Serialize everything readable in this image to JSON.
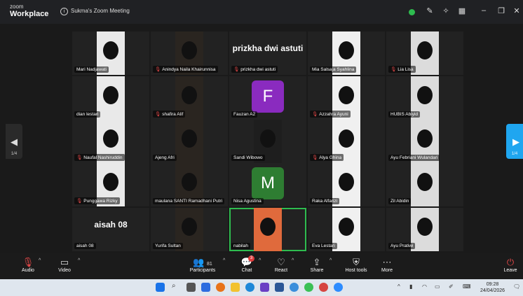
{
  "app": {
    "brand_top": "zoom",
    "brand_bottom": "Workplace",
    "meeting_title": "Sukma's Zoom Meeting"
  },
  "colors": {
    "accent": "#1fa6f0",
    "muted": "#e54848",
    "avatar_f": "#8a2bbf",
    "avatar_m": "#2e7d32",
    "active_speaker": "#2ebc4f"
  },
  "page": {
    "indicator_left": "1/4",
    "indicator_right": "1/4"
  },
  "tiles": [
    {
      "label": "Mari Nadjawati",
      "muted": false
    },
    {
      "label": "Anindya Naila Khairunnisa",
      "muted": true
    },
    {
      "label": "prizkha dwi astuti",
      "muted": true,
      "big": "prizkha dwi astuti"
    },
    {
      "label": "Mia Salsaja Syahlina",
      "muted": false
    },
    {
      "label": "Lia Lisa",
      "muted": true
    },
    {
      "label": "dian lestari",
      "muted": false
    },
    {
      "label": "shafira Alif",
      "muted": true
    },
    {
      "label": "Fauzan A2",
      "muted": false,
      "avatar": "F"
    },
    {
      "label": "Azzahra Ayuni",
      "muted": true
    },
    {
      "label": "HUBIS Abiyid",
      "muted": false
    },
    {
      "label": "Naufal Nashiruddin",
      "muted": true
    },
    {
      "label": "Ajeng Afri",
      "muted": false
    },
    {
      "label": "Sandi Wibowo",
      "muted": false
    },
    {
      "label": "Alya Ghina",
      "muted": true
    },
    {
      "label": "Ayu Febriani Wulandari",
      "muted": false
    },
    {
      "label": "Punggawa Rizky",
      "muted": true
    },
    {
      "label": "maulana SANTI Ramadhani Putri",
      "muted": false
    },
    {
      "label": "Nisa Agustina",
      "muted": false,
      "avatar": "M"
    },
    {
      "label": "Raka Alfarizi",
      "muted": false
    },
    {
      "label": "Zil Abidin",
      "muted": false
    },
    {
      "label": "aisah 08",
      "muted": false,
      "big": "aisah 08"
    },
    {
      "label": "Yurifa Sultan",
      "muted": false
    },
    {
      "label": "nabilah",
      "muted": false
    },
    {
      "label": "Eva Lestari",
      "muted": false
    },
    {
      "label": "Ayu Pratiwi",
      "muted": false
    }
  ],
  "controls": {
    "audio": "Audio",
    "video": "Video",
    "participants": "Participants",
    "participants_count": "81",
    "chat": "Chat",
    "chat_badge": "3",
    "react": "React",
    "share": "Share",
    "host_tools": "Host tools",
    "more": "More",
    "leave": "Leave"
  },
  "taskbar": {
    "time": "09:28",
    "date": "24/04/2026"
  }
}
